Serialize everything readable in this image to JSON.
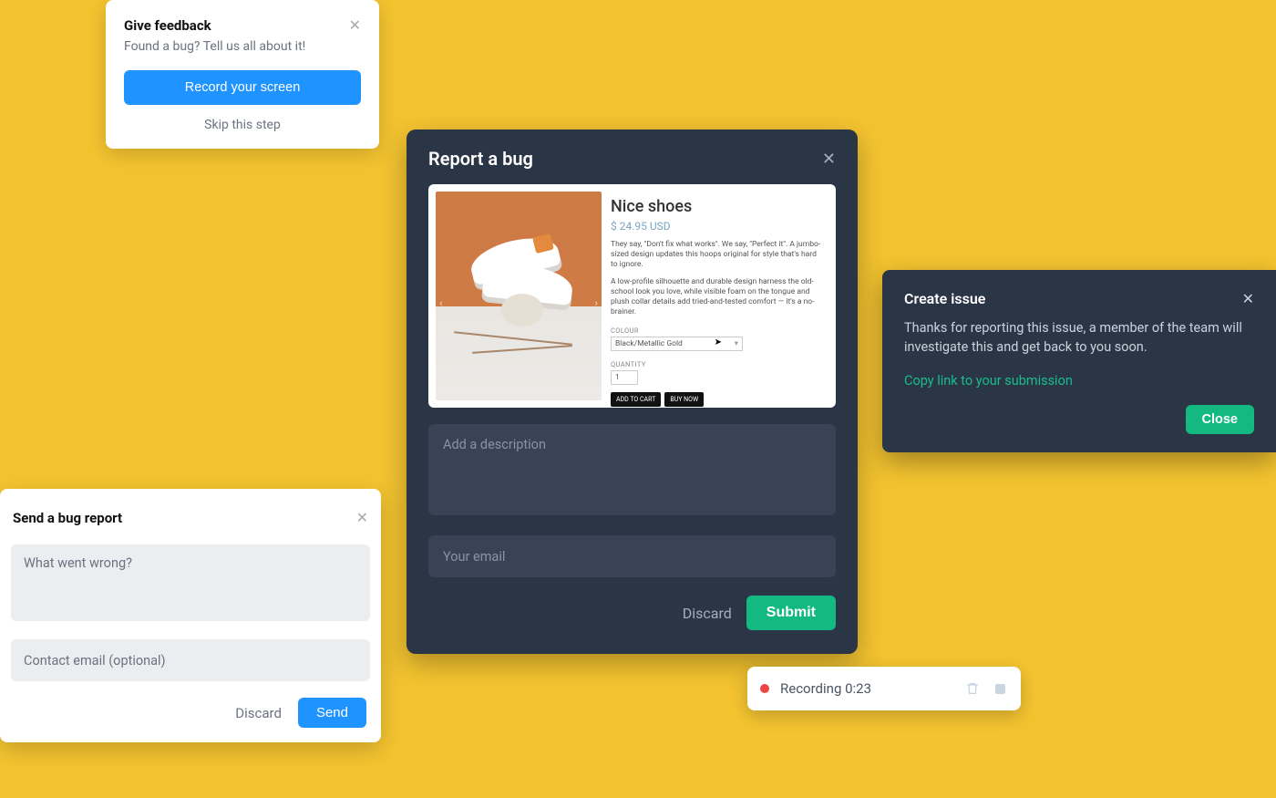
{
  "feedback": {
    "title": "Give feedback",
    "subtitle": "Found a bug? Tell us all about it!",
    "record_label": "Record your screen",
    "skip_label": "Skip this step"
  },
  "report": {
    "title": "Report a bug",
    "description_placeholder": "Add a description",
    "email_placeholder": "Your email",
    "discard_label": "Discard",
    "submit_label": "Submit",
    "screenshot": {
      "product_title": "Nice shoes",
      "price": "$ 24.95 USD",
      "p1": "They say, \"Don't fix what works\". We say, \"Perfect it\". A jumbo-sized design updates this hoops original for style that's hard to ignore.",
      "p2": "A low-profile silhouette and durable design harness the old-school look you love, while visible foam on the tongue and plush collar details add tried-and-tested comfort — it's a no-brainer.",
      "colour_label": "COLOUR",
      "colour_value": "Black/Metallic Gold",
      "quantity_label": "QUANTITY",
      "quantity_value": "1",
      "add_to_cart": "ADD TO CART",
      "buy_now": "BUY NOW"
    }
  },
  "send": {
    "title": "Send a bug report",
    "description_placeholder": "What went wrong?",
    "email_placeholder": "Contact email (optional)",
    "discard_label": "Discard",
    "send_label": "Send"
  },
  "toast": {
    "title": "Create issue",
    "body": "Thanks for reporting this issue, a member of the team will investigate this and get back to you soon.",
    "link_label": "Copy link to your submission",
    "close_label": "Close"
  },
  "recording": {
    "label": "Recording 0:23"
  }
}
